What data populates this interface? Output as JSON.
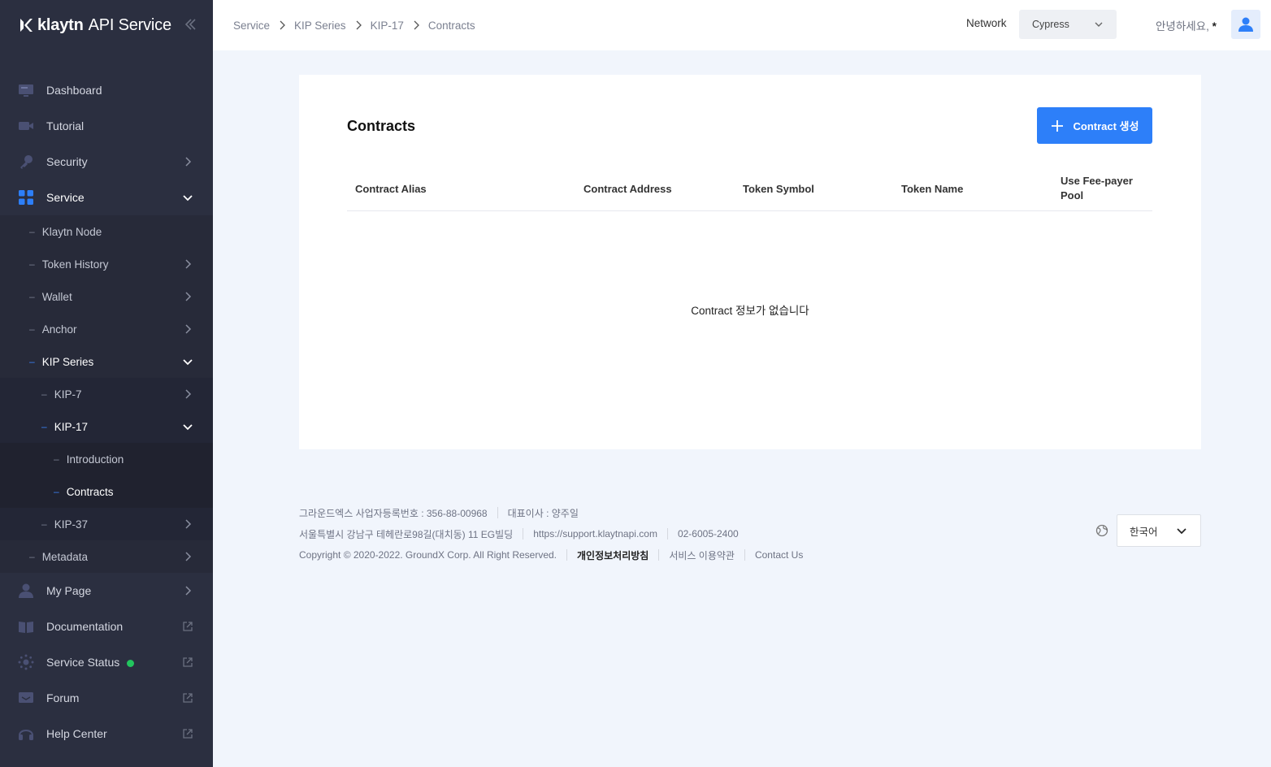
{
  "brand": {
    "name_bold": "klaytn",
    "name_light": "API Service"
  },
  "sidebar": {
    "dashboard": "Dashboard",
    "tutorial": "Tutorial",
    "security": "Security",
    "service": "Service",
    "klaytn_node": "Klaytn Node",
    "token_history": "Token History",
    "wallet": "Wallet",
    "anchor": "Anchor",
    "kip_series": "KIP Series",
    "kip7": "KIP-7",
    "kip17": "KIP-17",
    "introduction": "Introduction",
    "contracts": "Contracts",
    "kip37": "KIP-37",
    "metadata": "Metadata",
    "my_page": "My Page",
    "documentation": "Documentation",
    "service_status": "Service Status",
    "forum": "Forum",
    "help_center": "Help Center"
  },
  "colors": {
    "accent": "#2d7ff9",
    "status_ok": "#22c55e",
    "sidebar_bg": "#2b2f40"
  },
  "breadcrumb": [
    "Service",
    "KIP Series",
    "KIP-17",
    "Contracts"
  ],
  "header": {
    "network_label": "Network",
    "network_value": "Cypress",
    "greeting": "안녕하세요,",
    "greeting_user": "*"
  },
  "main": {
    "title": "Contracts",
    "create_button": "Contract 생성",
    "columns": [
      "Contract Alias",
      "Contract Address",
      "Token Symbol",
      "Token Name",
      "Use Fee-payer Pool"
    ],
    "empty_message": "Contract 정보가 없습니다"
  },
  "footer": {
    "company": "그라운드엑스 사업자등록번호 : 356-88-00968",
    "ceo": "대표이사 : 양주일",
    "address": "서울특별시 강남구 테헤란로98길(대치동) 11 EG빌딩",
    "support_url": "https://support.klaytnapi.com",
    "phone": "02-6005-2400",
    "copyright": "Copyright © 2020-2022. GroundX Corp. All Right Reserved.",
    "privacy": "개인정보처리방침",
    "terms": "서비스 이용약관",
    "contact": "Contact Us",
    "language": "한국어"
  }
}
